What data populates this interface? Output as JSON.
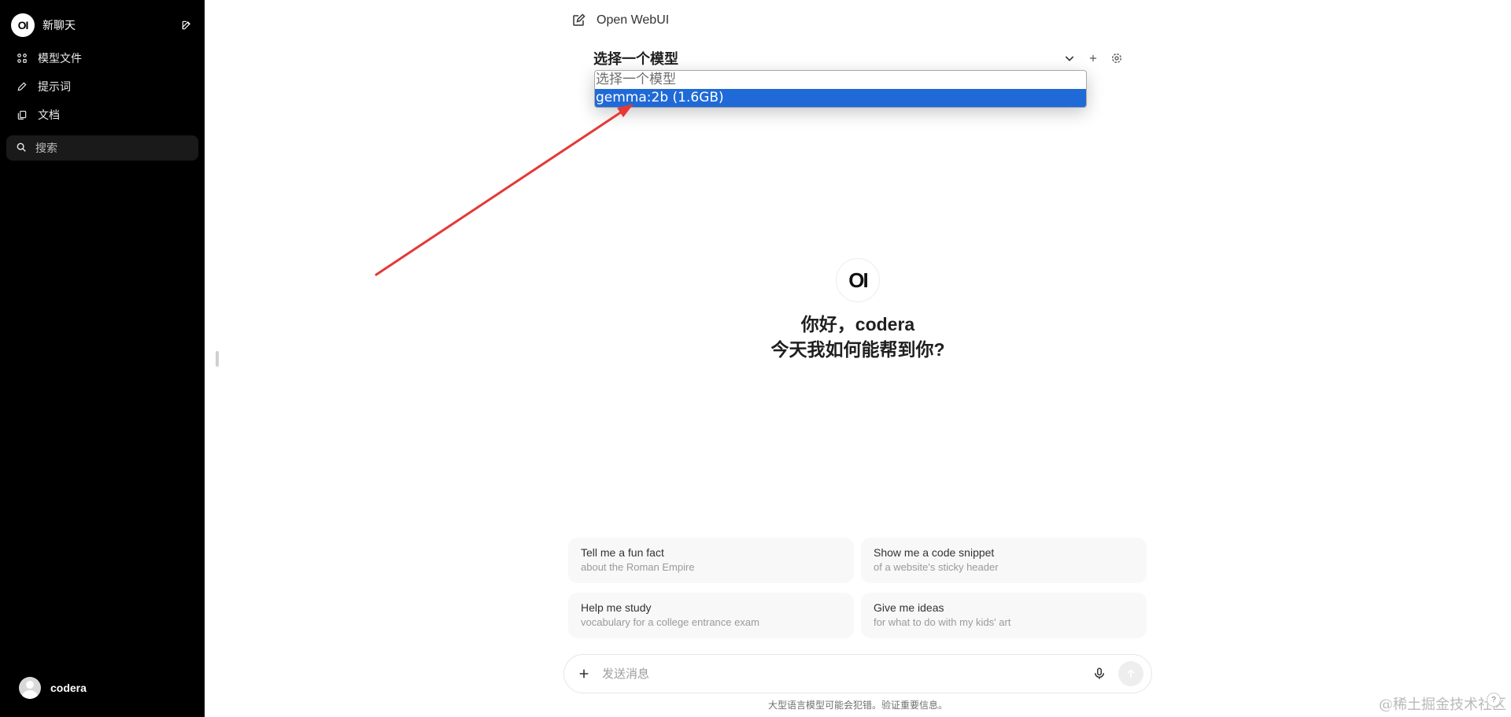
{
  "sidebar": {
    "logo_text": "OI",
    "new_chat": "新聊天",
    "items": [
      {
        "label": "模型文件",
        "icon": "grid-icon"
      },
      {
        "label": "提示词",
        "icon": "pencil-icon"
      },
      {
        "label": "文档",
        "icon": "document-icon"
      }
    ],
    "search_placeholder": "搜索",
    "user_name": "codera"
  },
  "header": {
    "title": "Open WebUI"
  },
  "model_selector": {
    "label": "选择一个模型",
    "options": [
      {
        "label": "选择一个模型",
        "selected": false
      },
      {
        "label": "gemma:2b (1.6GB)",
        "selected": true
      }
    ]
  },
  "welcome": {
    "logo_text": "OI",
    "line1": "你好，codera",
    "line2": "今天我如何能帮到你?"
  },
  "suggestions": [
    {
      "title": "Tell me a fun fact",
      "subtitle": "about the Roman Empire"
    },
    {
      "title": "Show me a code snippet",
      "subtitle": "of a website's sticky header"
    },
    {
      "title": "Help me study",
      "subtitle": "vocabulary for a college entrance exam"
    },
    {
      "title": "Give me ideas",
      "subtitle": "for what to do with my kids' art"
    }
  ],
  "composer": {
    "placeholder": "发送消息",
    "disclaimer": "大型语言模型可能会犯错。验证重要信息。"
  },
  "watermark": "@稀土掘金技术社区",
  "help_badge": "?",
  "colors": {
    "sidebar_bg": "#000000",
    "selected_option": "#1f6ad6",
    "annotation_arrow": "#e53935"
  }
}
